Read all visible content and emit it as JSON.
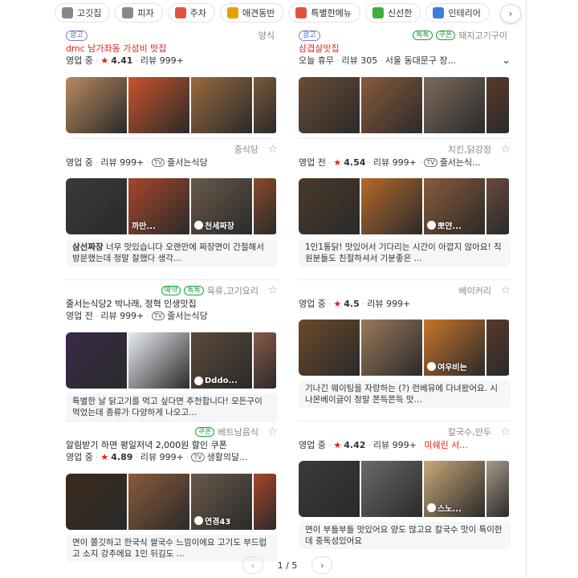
{
  "categories": [
    {
      "icon": "utensils-icon",
      "label": "고깃집",
      "color": "#888"
    },
    {
      "icon": "utensils-icon",
      "label": "피자",
      "color": "#888"
    },
    {
      "icon": "parking-icon",
      "label": "주차",
      "color": "#e0533f"
    },
    {
      "icon": "dog-icon",
      "label": "애견동반",
      "color": "#e5a000"
    },
    {
      "icon": "gift-icon",
      "label": "특별한메뉴",
      "color": "#e0533f"
    },
    {
      "icon": "leaf-icon",
      "label": "신선한",
      "color": "#3cb043"
    },
    {
      "icon": "sofa-icon",
      "label": "인테리어",
      "color": "#3b7de0"
    }
  ],
  "chip_next": "›",
  "ad_label": "광고",
  "tv_label": "TV",
  "star_glyph": "★",
  "bookmark_glyph": "☆",
  "pager": {
    "prev": "‹",
    "current": "1",
    "sep": "/",
    "total": "5",
    "next": "›"
  },
  "cards": [
    {
      "ad": true,
      "name": "",
      "category": "양식",
      "badges": [],
      "promo": "dmc 남가좌동 가성비 맛집",
      "promo_red": true,
      "status": "영업 중",
      "rating": "4.41",
      "reviews": "리뷰 999+",
      "extra": "",
      "tv": false,
      "photo_label": "",
      "review": "",
      "photo_colors": [
        "#b98a5e",
        "#c9542b",
        "#9a6b3e",
        "#7a5a3a"
      ]
    },
    {
      "ad": true,
      "name": "",
      "category": "돼지고기구이",
      "badges": [
        "톡톡",
        "쿠폰"
      ],
      "promo": "삼겹살맛집",
      "promo_red": true,
      "status": "오늘 휴무",
      "rating": "",
      "reviews": "리뷰 305",
      "extra": "서울 동대문구 장...",
      "tv": false,
      "photo_label": "",
      "review": "",
      "photo_colors": [
        "#6b4c36",
        "#8a5a3c",
        "#7d6a5c",
        "#5a3a2a"
      ]
    },
    {
      "ad": false,
      "name": "",
      "category": "중식당",
      "badges": [],
      "promo": "",
      "status": "영업 중",
      "rating": "",
      "reviews": "리뷰 999+",
      "extra": "줄서는식당",
      "tv": true,
      "photo_label": "천세짜장",
      "photo_label2": "까만...",
      "review_bold": "삼선짜장",
      "review": " 너무 맛있습니다 오랜만에 짜장면이 간절해서 방문했는데 정말 잘했다 생각...",
      "photo_colors": [
        "#3a3a3a",
        "#a8462a",
        "#6a5a4a",
        "#8a4a2a"
      ]
    },
    {
      "ad": false,
      "name": "",
      "category": "치킨,닭강정",
      "badges": [],
      "promo": "",
      "status": "영업 전",
      "rating": "4.54",
      "reviews": "리뷰 999+",
      "extra": "줄서는식...",
      "tv": true,
      "photo_label": "뽀얀...",
      "review": "1인1통닭! 맛있어서 기다리는 시간이 아깝지 않아요! 직원분들도 친절하셔서 기분좋은 ...",
      "photo_colors": [
        "#4a3a2a",
        "#b56a2a",
        "#8a5a3a",
        "#6a4a3a"
      ]
    },
    {
      "ad": false,
      "name": "",
      "category": "육류,고기요리",
      "badges": [
        "예약",
        "톡톡"
      ],
      "promo": "줄서는식당2 박나래, 정혁 인생맛집",
      "promo_red": false,
      "status": "영업 전",
      "rating": "",
      "reviews": "리뷰 999+",
      "extra": "줄서는식당",
      "tv": true,
      "photo_label": "Dddo...",
      "review": "특별한 날 닭고기를 먹고 싶다면 추천합니다! 모든구이 먹었는데 종류가 다양하게 나오고...",
      "photo_colors": [
        "#3a2a4a",
        "#e8ecf2",
        "#5a4a3a",
        "#8a5a4a"
      ]
    },
    {
      "ad": false,
      "name": "",
      "category": "베이커리",
      "badges": [],
      "promo": "",
      "status": "영업 중",
      "rating": "4.5",
      "reviews": "리뷰 999+",
      "extra": "",
      "tv": false,
      "photo_label": "여우비는",
      "review": "기나긴 웨이팅을 자랑하는 (?) 런베뮤에 다녀왔어요. 시나몬베이글이 정말 쫀득쫀득 맛...",
      "photo_colors": [
        "#6a4a2a",
        "#9a7a5a",
        "#c8742a",
        "#5a3a2a"
      ]
    },
    {
      "ad": false,
      "name": "",
      "category": "베트남음식",
      "badges": [
        "쿠폰"
      ],
      "promo": "알림받기 하면 평일저녁 2,000원 할인 쿠폰",
      "promo_red": false,
      "status": "영업 중",
      "rating": "4.89",
      "reviews": "리뷰 999+",
      "extra": "생활의달...",
      "tv": true,
      "photo_label": "연경43",
      "review": "면이 쫄깃하고 한국식 쌀국수 느낌이에요 고기도 부드럽고 소지 강추에요 1인 뒤김도 ...",
      "photo_colors": [
        "#3a2a1a",
        "#8a5a3a",
        "#6a5a4a",
        "#a8462a"
      ]
    },
    {
      "ad": false,
      "name": "",
      "category": "칼국수,만두",
      "badges": [],
      "promo": "",
      "status": "영업 중",
      "rating": "4.42",
      "reviews": "리뷰 999+",
      "extra": "미쉐린 서...",
      "tv": false,
      "michelin": true,
      "photo_label": "스노...",
      "review": "면이 부들부들 맛있어요 양도 많고요 칼국수 맛이 특이한데 중독성있어요",
      "photo_colors": [
        "#3a3a3a",
        "#6a6a6a",
        "#c8a87a",
        "#a89a8a"
      ]
    }
  ]
}
